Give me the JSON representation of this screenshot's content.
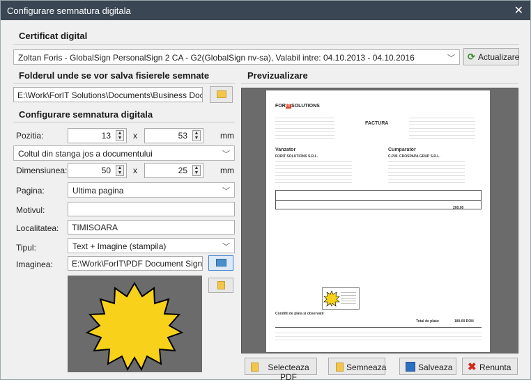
{
  "window": {
    "title": "Configurare semnatura digitala"
  },
  "certificat": {
    "heading": "Certificat digital",
    "value": "Zoltan Foris - GlobalSign PersonalSign 2 CA - G2(GlobalSign nv-sa), Valabil intre: 04.10.2013 - 04.10.2016",
    "refresh_label": "Actualizare"
  },
  "folder": {
    "heading": "Folderul unde se vor salva fisierele semnate",
    "path": "E:\\Work\\ForIT Solutions\\Documents\\Business Documents"
  },
  "config": {
    "heading": "Configurare semnatura digitala",
    "pozitia_label": "Pozitia:",
    "pozitia_x": "13",
    "pozitia_y": "53",
    "x_label": "x",
    "unit_mm": "mm",
    "corner": "Coltul din stanga jos a documentului",
    "dimensiunea_label": "Dimensiunea:",
    "dim_w": "50",
    "dim_h": "25",
    "pagina_label": "Pagina:",
    "pagina_value": "Ultima pagina",
    "motivul_label": "Motivul:",
    "motivul_value": "",
    "localitatea_label": "Localitatea:",
    "localitatea_value": "TIMISOARA",
    "tipul_label": "Tipul:",
    "tipul_value": "Text + Imagine (stampila)",
    "imaginea_label": "Imaginea:",
    "imaginea_value": "E:\\Work\\ForIT\\PDF Document Signing\\Fc"
  },
  "preview": {
    "heading": "Previzualizare",
    "doc": {
      "logo_a": "FOR",
      "logo_b": "IT",
      "logo_c": "SOLUTIONS",
      "doc_type": "FACTURA",
      "seller_h": "Vanzator",
      "seller": "FORIT SOLUTIONS S.R.L.",
      "buyer_h": "Cumparator",
      "buyer": "C.P.M. CROSPAPA GRUP S.R.L.",
      "item_total": "200.00",
      "total_label": "Total de plata:",
      "total_value": "180.00 RON",
      "footer": "Conditii de plata si observatii"
    }
  },
  "actions": {
    "select_pdf": "Selecteaza PDF",
    "sign": "Semneaza",
    "save": "Salveaza",
    "cancel": "Renunta"
  },
  "colors": {
    "titlebar": "#3a4654",
    "stamp_yellow": "#f8d21a",
    "preview_bg": "#6b6b6b",
    "brand_red": "#e03a1e"
  }
}
